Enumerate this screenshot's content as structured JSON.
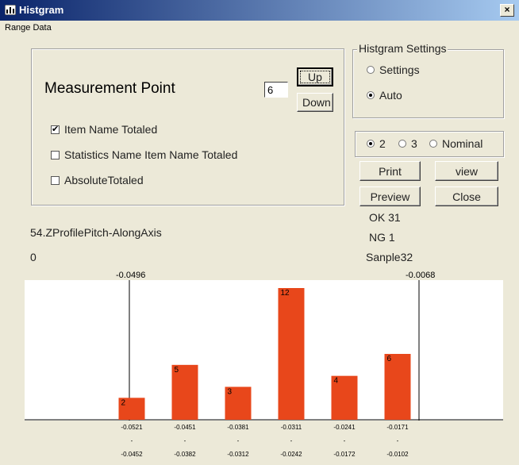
{
  "window": {
    "title": "Histgram",
    "close_label": "×"
  },
  "menu": {
    "range_data": "Range Data"
  },
  "measurement": {
    "label": "Measurement Point",
    "value": "6",
    "up_label": "Up",
    "down_label": "Down",
    "options": [
      {
        "label": "Item Name Totaled",
        "checked": true
      },
      {
        "label": "Statistics Name Item Name Totaled",
        "checked": false
      },
      {
        "label": "AbsoluteTotaled",
        "checked": false
      }
    ]
  },
  "histgram_settings": {
    "title": "Histgram Settings",
    "settings_label": "Settings",
    "auto_label": "Auto",
    "selected": "Auto"
  },
  "mode_options": {
    "opt2": "2",
    "opt3": "3",
    "nominal": "Nominal",
    "selected": "2"
  },
  "buttons": {
    "print": "Print",
    "view": "view",
    "preview": "Preview",
    "close": "Close"
  },
  "stats": {
    "ok": "OK 31",
    "ng": "NG 1",
    "sample": "Sanple32"
  },
  "item_name": "54.ZProfilePitch-AlongAxis",
  "zero_label": "0",
  "chart_data": {
    "type": "bar",
    "lower_limit": "-0.0496",
    "upper_limit": "-0.0068",
    "lower_limit_value": -0.0496,
    "upper_limit_value": -0.0068,
    "bins": [
      {
        "from": "-0.0521",
        "sep": "-",
        "to": "-0.0452",
        "count": 2
      },
      {
        "from": "-0.0451",
        "sep": "-",
        "to": "-0.0382",
        "count": 5
      },
      {
        "from": "-0.0381",
        "sep": "-",
        "to": "-0.0312",
        "count": 3
      },
      {
        "from": "-0.0311",
        "sep": "-",
        "to": "-0.0242",
        "count": 12
      },
      {
        "from": "-0.0241",
        "sep": "-",
        "to": "-0.0172",
        "count": 4
      },
      {
        "from": "-0.0171",
        "sep": "-",
        "to": "-0.0102",
        "count": 6
      }
    ],
    "values": [
      2,
      5,
      3,
      12,
      4,
      6
    ],
    "ylim": [
      0,
      12
    ],
    "bar_color": "#e8471b"
  }
}
